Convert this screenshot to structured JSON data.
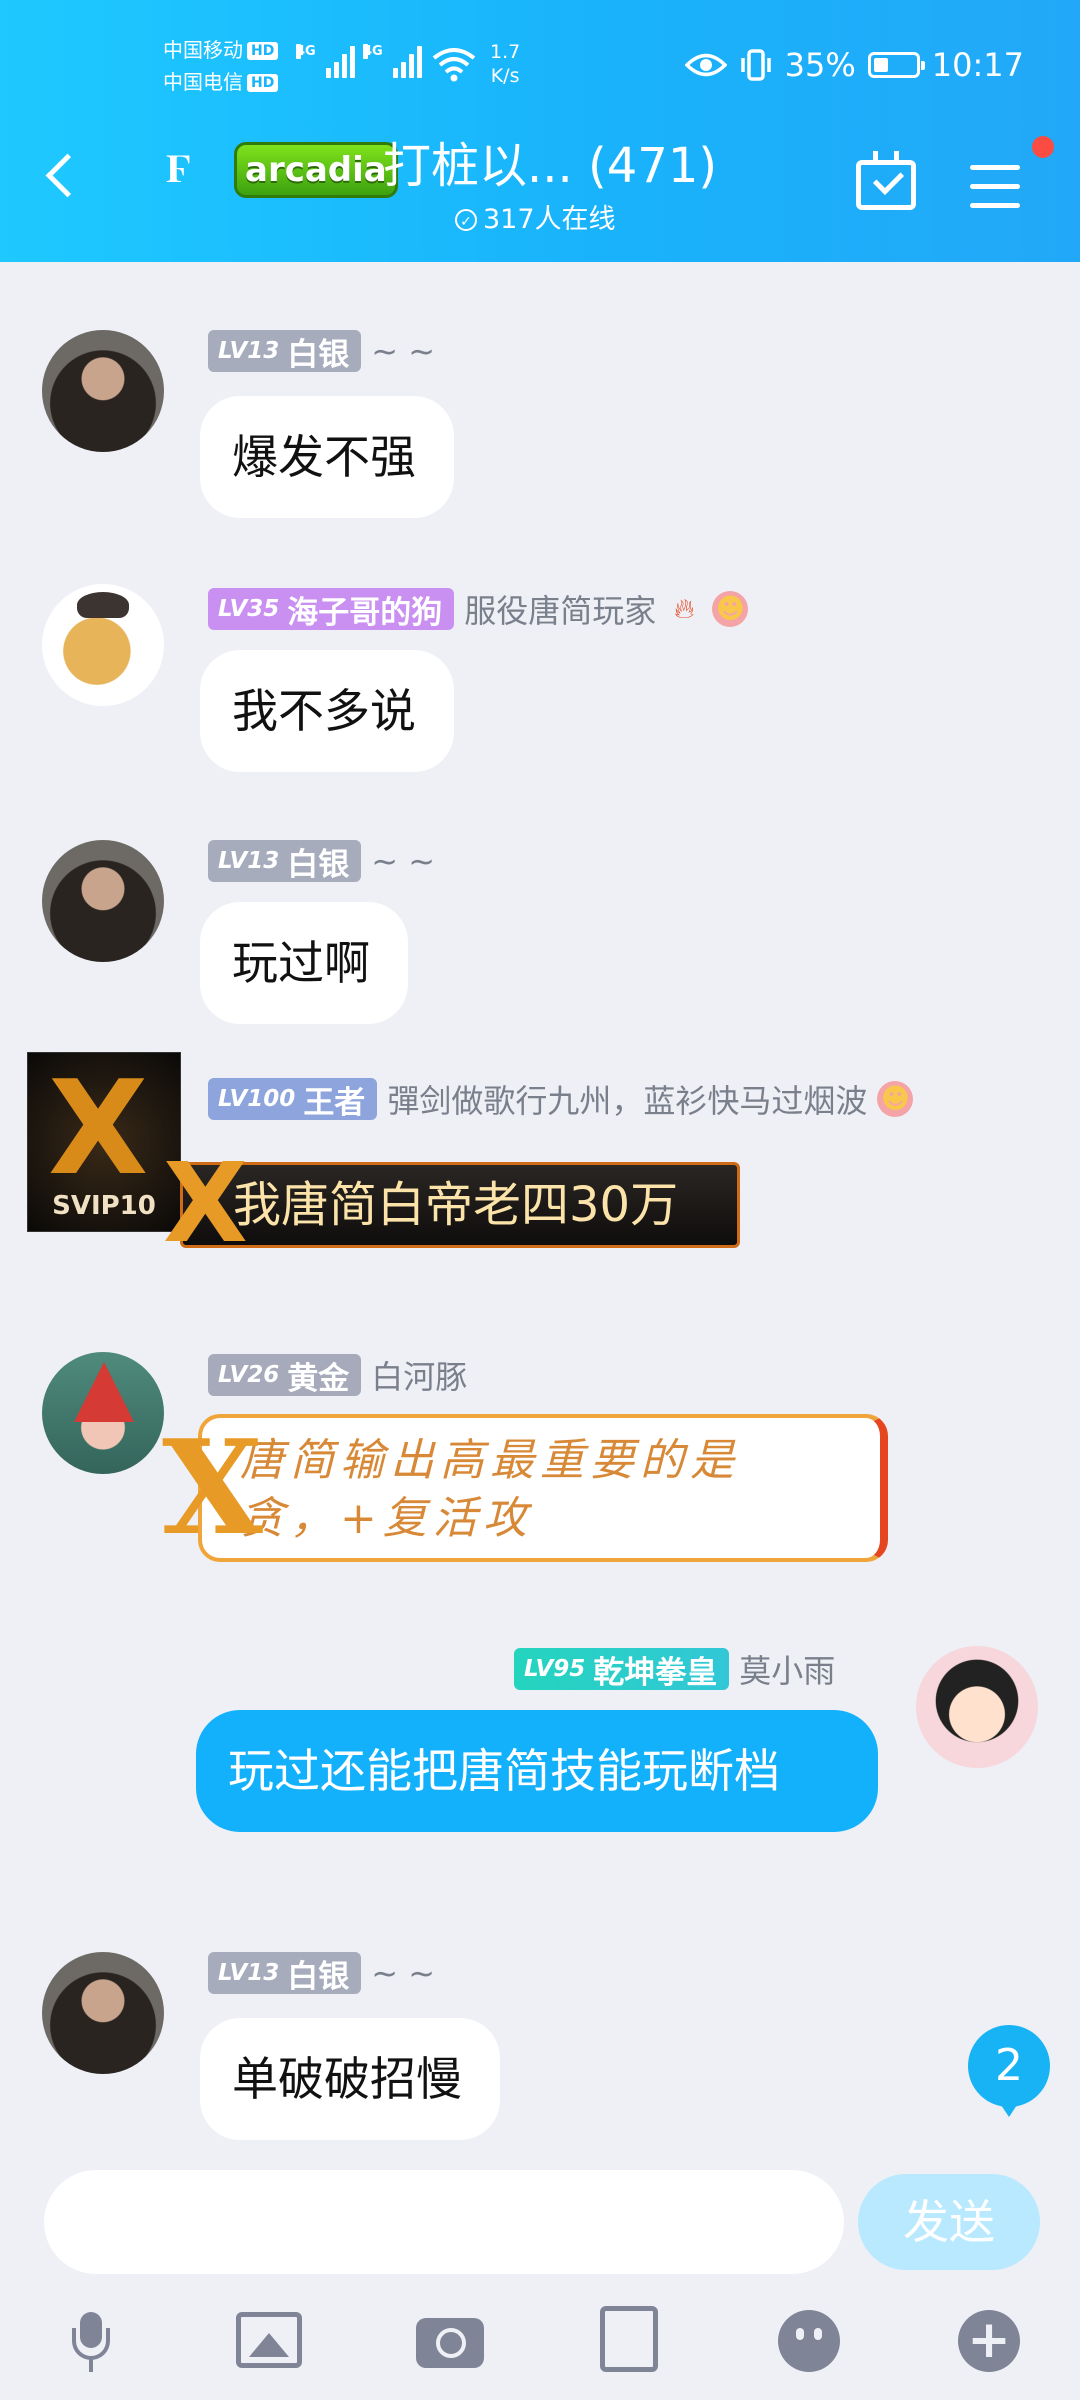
{
  "status_bar": {
    "carrier1": "中国移动",
    "carrier2": "中国电信",
    "hd": "HD",
    "net1": "4G",
    "net2": "4G",
    "speed_value": "1.7",
    "speed_unit": "K/s",
    "battery_pct": "35%",
    "battery_level": 0.35,
    "time": "10:17"
  },
  "header": {
    "badge": "arcadia",
    "title": "打桩以... (471)",
    "online": "317人在线"
  },
  "messages": [
    {
      "level": "LV13",
      "level_title": "白银",
      "nick": "~ ~",
      "text": "爆发不强"
    },
    {
      "level": "LV35",
      "level_title": "海子哥的狗",
      "nick": "服役唐简玩家",
      "text": "我不多说"
    },
    {
      "level": "LV13",
      "level_title": "白银",
      "nick": "~ ~",
      "text": "玩过啊"
    },
    {
      "level": "LV100",
      "level_title": "王者",
      "nick": "彈剑做歌行九州，蓝衫快马过烟波",
      "avatar_label": "SVIP10",
      "text": "我唐简白帝老四30万"
    },
    {
      "level": "LV26",
      "level_title": "黄金",
      "nick": "白河豚",
      "text_line1": "唐简输出高最重要的是",
      "text_line2": "贪，+复活攻"
    },
    {
      "level": "LV95",
      "level_title": "乾坤拳皇",
      "nick": "莫小雨",
      "text": "玩过还能把唐简技能玩断档"
    },
    {
      "level": "LV13",
      "level_title": "白银",
      "nick": "~ ~",
      "text": "单破破招慢"
    }
  ],
  "unread_count": "2",
  "input": {
    "placeholder": "",
    "send_label": "发送"
  },
  "toolbar_icons": [
    "mic-icon",
    "image-icon",
    "camera-icon",
    "red-packet-icon",
    "emoji-icon",
    "plus-icon"
  ]
}
